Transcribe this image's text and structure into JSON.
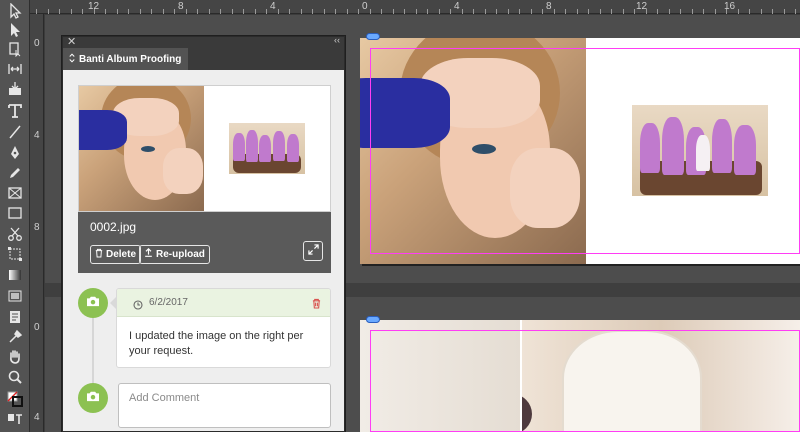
{
  "panel": {
    "title": "Banti Album Proofing",
    "file_name": "0002.jpg",
    "delete_label": "Delete",
    "reupload_label": "Re-upload"
  },
  "comment": {
    "date": "6/2/2017",
    "text": "I updated the image on the right per your request."
  },
  "add_comment": {
    "placeholder": "Add Comment"
  },
  "ruler": {
    "h_labels": [
      "12",
      "8",
      "4",
      "0",
      "4",
      "8",
      "12",
      "16"
    ],
    "v_labels_top": [
      "0",
      "4",
      "8"
    ],
    "v_labels_bottom": [
      "0",
      "4"
    ]
  },
  "colors": {
    "accent_green": "#8cc152",
    "guide_magenta": "#ff3df5",
    "sleeve_blue": "#2a2ea0",
    "bridesmaid_purple": "#c07acd"
  },
  "tool_icons": [
    "selection-icon",
    "direct-selection-icon",
    "page-icon",
    "gap-icon",
    "content-collector-icon",
    "type-icon",
    "line-icon",
    "pen-icon",
    "pencil-icon",
    "rectangle-frame-icon",
    "rectangle-icon",
    "scissors-icon",
    "free-transform-icon",
    "gradient-swatch-icon",
    "gradient-feather-icon",
    "note-icon",
    "eyedropper-icon",
    "hand-icon",
    "zoom-icon",
    "fill-stroke-icon",
    "formatting-text-icon"
  ]
}
